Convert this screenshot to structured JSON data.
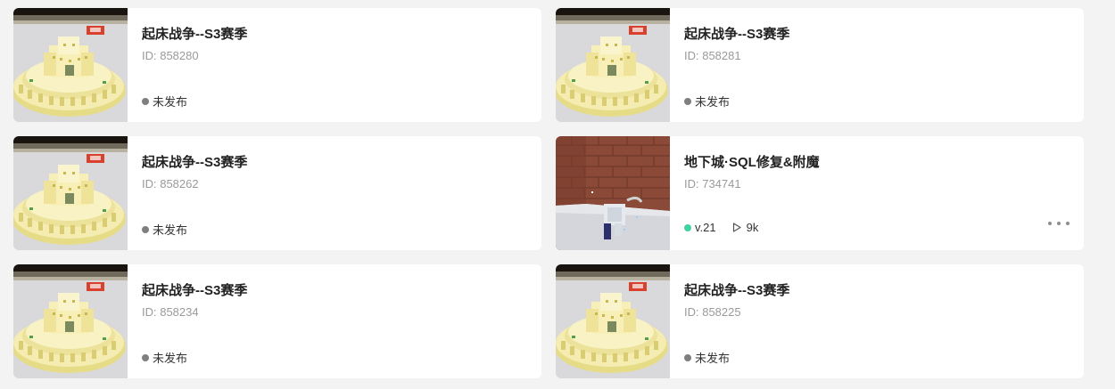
{
  "cards": [
    {
      "title": "起床战争--S3赛季",
      "id": "ID: 858280",
      "status": "未发布",
      "thumb": "castle"
    },
    {
      "title": "起床战争--S3赛季",
      "id": "ID: 858281",
      "status": "未发布",
      "thumb": "castle"
    },
    {
      "title": "起床战争--S3赛季",
      "id": "ID: 858262",
      "status": "未发布",
      "thumb": "castle"
    },
    {
      "title": "地下城·SQL修复&附魔",
      "id": "ID: 734741",
      "version": "v.21",
      "plays": "9k",
      "thumb": "dungeon",
      "has_more_menu": true
    },
    {
      "title": "起床战争--S3赛季",
      "id": "ID: 858234",
      "status": "未发布",
      "thumb": "castle"
    },
    {
      "title": "起床战争--S3赛季",
      "id": "ID: 858225",
      "status": "未发布",
      "thumb": "castle"
    }
  ],
  "colors": {
    "unpublished_dot": "#7f7f7f",
    "published_dot": "#3fd3a2",
    "card_bg": "#ffffff",
    "page_bg": "#f3f3f3"
  },
  "icons": {
    "status_dot": "status-dot-icon",
    "plays": "play-icon",
    "more": "more-dots-icon"
  }
}
